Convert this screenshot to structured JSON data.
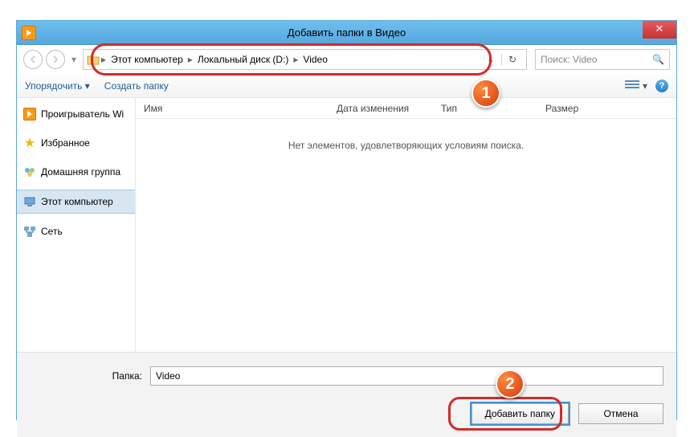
{
  "window": {
    "title": "Добавить папки в Видео"
  },
  "breadcrumbs": {
    "b0": "Этот компьютер",
    "b1": "Локальный диск (D:)",
    "b2": "Video"
  },
  "search": {
    "placeholder": "Поиск: Video"
  },
  "toolbar": {
    "organize": "Упорядочить",
    "newfolder": "Создать папку"
  },
  "sidebar": {
    "items": {
      "player": "Проигрыватель Wi",
      "fav": "Избранное",
      "home": "Домашняя группа",
      "pc": "Этот компьютер",
      "net": "Сеть"
    }
  },
  "columns": {
    "name": "Имя",
    "date": "Дата изменения",
    "type": "Тип",
    "size": "Размер"
  },
  "empty": "Нет элементов, удовлетворяющих условиям поиска.",
  "bottom": {
    "folder_label": "Папка:",
    "folder_value": "Video",
    "add": "Добавить папку",
    "cancel": "Отмена"
  },
  "callouts": {
    "c1": "1",
    "c2": "2"
  }
}
